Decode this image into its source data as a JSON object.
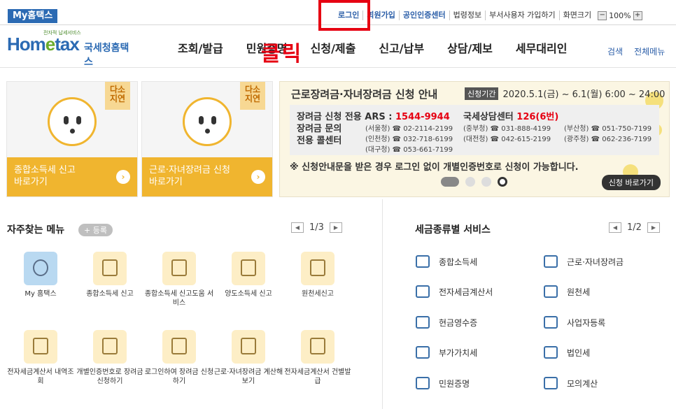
{
  "topbar": {
    "badge": "My홈택스",
    "links": [
      "로그인",
      "회원가입",
      "공인인증센터",
      "법령정보",
      "부서사용자 가입하기",
      "화면크기"
    ],
    "zoom": "100%",
    "zoom_minus": "−",
    "zoom_plus": "+"
  },
  "logo": {
    "small": "전자적 납세서비스",
    "home": "Hom",
    "e": "e",
    "tax": "tax",
    "name": "국세청홈택스"
  },
  "annotation": "클릭",
  "nav": {
    "items": [
      "조회/발급",
      "민원증명",
      "신청/제출",
      "신고/납부",
      "상담/제보",
      "세무대리인"
    ],
    "search": "검색",
    "all_menu": "전체메뉴"
  },
  "cards": [
    {
      "tag": "다소 지연",
      "label1": "종합소득세 신고",
      "label2": "바로가기",
      "arrow": "›"
    },
    {
      "tag": "다소 지연",
      "label1": "근로·자녀장려금 신청",
      "label2": "바로가기",
      "arrow": "›"
    }
  ],
  "banner": {
    "title": "근로장려금·자녀장려금 신청 안내",
    "period_label": "신청기간",
    "period": "2020.5.1(금) ~ 6.1(월) 6:00 ~ 24:00",
    "ars_label": "장려금 신청 전용 ARS :",
    "ars": "1544-9944",
    "center_label": "국세상담센터",
    "center": "126(6번)",
    "inquiry_label1": "장려금 문의",
    "inquiry_label2": "전용 콜센터",
    "phones": [
      "(서울청) ☎ 02-2114-2199",
      "(중부청) ☎ 031-888-4199",
      "(부산청) ☎ 051-750-7199",
      "(인천청) ☎ 032-718-6199",
      "(대전청) ☎ 042-615-2199",
      "(광주청) ☎ 062-236-7199",
      "(대구청) ☎ 053-661-7199"
    ],
    "note": "※ 신청안내문을 받은 경우 로그인 없이 개별인증번호로 신청이 가능합니다.",
    "button": "신청 바로가기"
  },
  "freq": {
    "title": "자주찾는 메뉴",
    "add": "+ 등록",
    "page": "1/3",
    "items": [
      {
        "label": "My 홈택스",
        "icon": "user-icon"
      },
      {
        "label": "종합소득세 신고",
        "icon": "calendar-icon"
      },
      {
        "label": "종합소득세 신고도움 서비스",
        "icon": "document-icon"
      },
      {
        "label": "양도소득세 신고",
        "icon": "house-icon"
      },
      {
        "label": "원천세신고",
        "icon": "calendar-icon"
      },
      {
        "label": "전자세금계산서 내역조회",
        "icon": "search-document-icon"
      },
      {
        "label": "개별인증번호로 장려금 신청하기",
        "icon": "heart-icon"
      },
      {
        "label": "로그인하여 장려금 신청하기",
        "icon": "heart-icon"
      },
      {
        "label": "근로·자녀장려금 계산해보기",
        "icon": "heart-icon"
      },
      {
        "label": "전자세금계산서 건별발급",
        "icon": "calculator-icon"
      }
    ]
  },
  "taxtype": {
    "title": "세금종류별 서비스",
    "page": "1/2",
    "items": [
      {
        "label": "종합소득세",
        "icon": "won-bag-icon"
      },
      {
        "label": "근로·자녀장려금",
        "icon": "heart-icon"
      },
      {
        "label": "전자세금계산서",
        "icon": "invoice-icon"
      },
      {
        "label": "원천세",
        "icon": "document-icon"
      },
      {
        "label": "현금영수증",
        "icon": "receipt-icon"
      },
      {
        "label": "사업자등록",
        "icon": "person-icon"
      },
      {
        "label": "부가가치세",
        "icon": "vat-icon"
      },
      {
        "label": "법인세",
        "icon": "building-icon"
      },
      {
        "label": "민원증명",
        "icon": "certificate-icon"
      },
      {
        "label": "모의계산",
        "icon": "calculator-icon"
      }
    ]
  }
}
